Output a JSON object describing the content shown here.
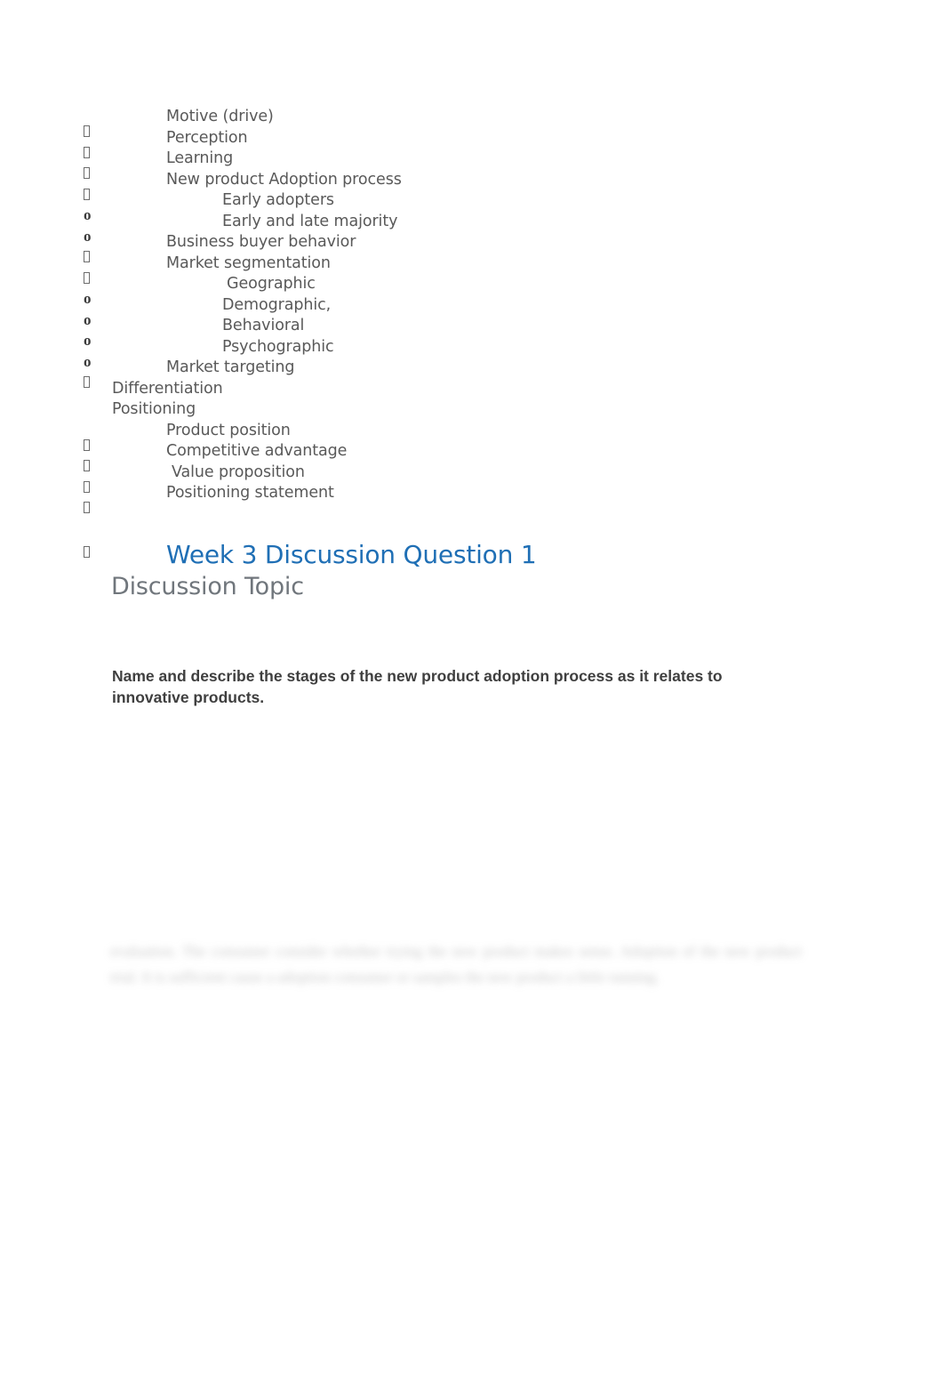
{
  "document": {
    "outline": [
      {
        "bullet": "box",
        "level": 1,
        "text": "Motive (drive)"
      },
      {
        "bullet": "box",
        "level": 1,
        "text": "Perception"
      },
      {
        "bullet": "box",
        "level": 1,
        "text": "Learning"
      },
      {
        "bullet": "box",
        "level": 1,
        "text": "New product Adoption process"
      },
      {
        "bullet": "o",
        "level": 2,
        "text": "Early adopters"
      },
      {
        "bullet": "o",
        "level": 2,
        "text": "Early and late majority"
      },
      {
        "bullet": "box",
        "level": 1,
        "text": "Business buyer behavior"
      },
      {
        "bullet": "box",
        "level": 1,
        "text": "Market segmentation"
      },
      {
        "bullet": "o",
        "level": "2geo",
        "text": "Geographic"
      },
      {
        "bullet": "o",
        "level": 2,
        "text": "Demographic,"
      },
      {
        "bullet": "o",
        "level": 2,
        "text": "Behavioral"
      },
      {
        "bullet": "o",
        "level": 2,
        "text": "Psychographic"
      },
      {
        "bullet": "box",
        "level": 1,
        "text": "Market targeting"
      },
      {
        "bullet": "none",
        "level": 0,
        "text": "Differentiation"
      },
      {
        "bullet": "none",
        "level": 0,
        "text": "Positioning"
      },
      {
        "bullet": "box",
        "level": 1,
        "text": "Product position"
      },
      {
        "bullet": "box",
        "level": 1,
        "text": "Competitive advantage"
      },
      {
        "bullet": "box",
        "level": "1pad",
        "text": "Value proposition"
      },
      {
        "bullet": "box",
        "level": 1,
        "text": "Positioning statement"
      }
    ],
    "heading": {
      "title": "Week 3 Discussion Question 1",
      "subtitle": "Discussion Topic"
    },
    "prompt": "Name and describe the stages of the new product adoption process as it relates to innovative products.",
    "obscured_paragraph": "evaluation. The consumer consider whether trying the new product makes sense. Adoption of the new product trial. It is sufficient cause a adoption consumer or samples the new product a little running.",
    "colors": {
      "heading_blue": "#1F6FB5",
      "subtitle_gray": "#70767C",
      "body_gray": "#595959",
      "prompt_dark": "#3F3F3F",
      "page_background": "#FFFFFF"
    }
  }
}
